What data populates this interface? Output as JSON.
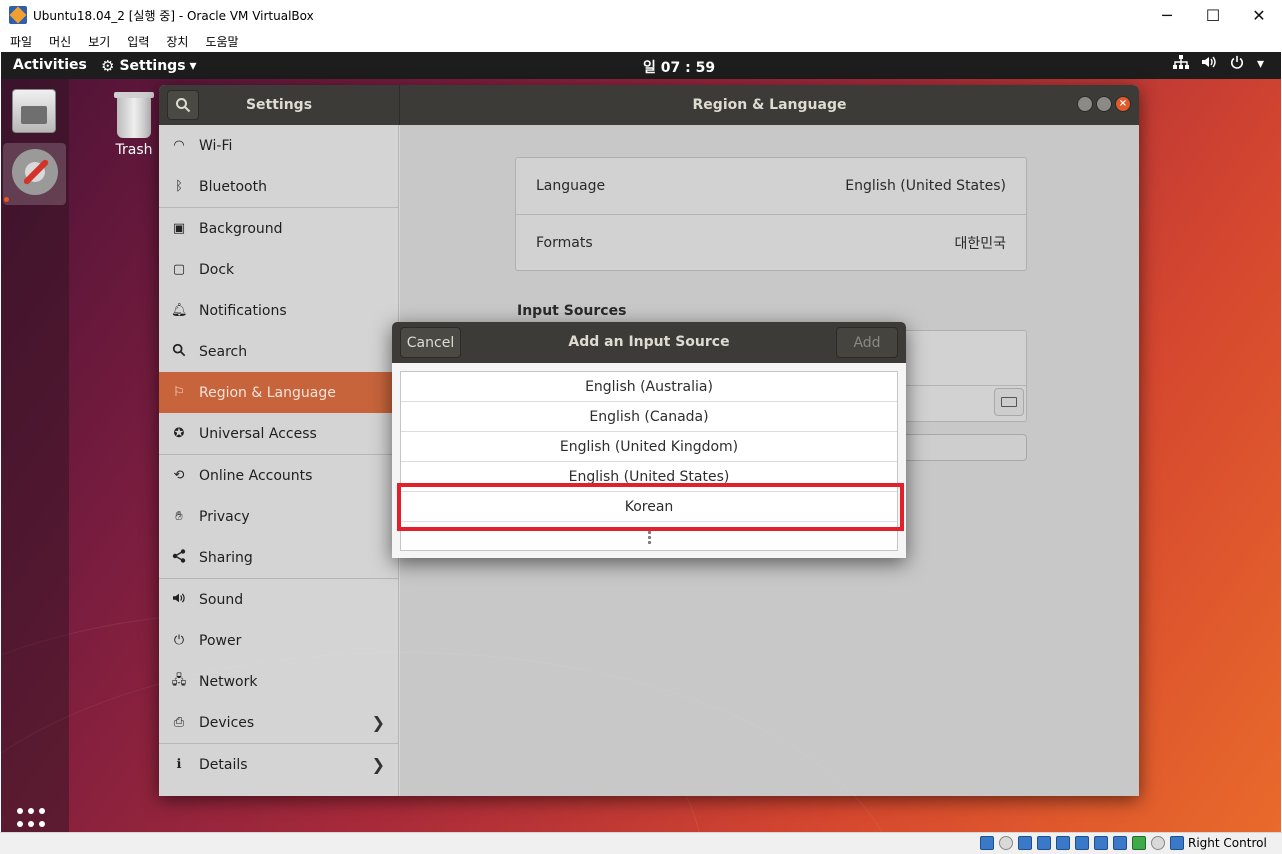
{
  "host": {
    "window_title": "Ubuntu18.04_2 [실행 중] - Oracle VM VirtualBox",
    "controls": {
      "minimize": "─",
      "maximize": "☐",
      "close": "✕"
    },
    "menu": [
      "파일",
      "머신",
      "보기",
      "입력",
      "장치",
      "도움말"
    ],
    "status_host_key": "Right Control"
  },
  "topbar": {
    "activities": "Activities",
    "app_menu": "Settings",
    "app_menu_arrow": "▾",
    "clock": "일 07 : 59"
  },
  "desktop": {
    "trash_label": "Trash"
  },
  "settings_window": {
    "sidebar_title": "Settings",
    "page_title": "Region & Language",
    "sidebar_items": [
      {
        "label": "Wi-Fi",
        "icon": "wifi-icon"
      },
      {
        "label": "Bluetooth",
        "icon": "bluetooth-icon"
      },
      {
        "label": "Background",
        "icon": "background-icon"
      },
      {
        "label": "Dock",
        "icon": "dock-icon"
      },
      {
        "label": "Notifications",
        "icon": "bell-icon"
      },
      {
        "label": "Search",
        "icon": "search-icon"
      },
      {
        "label": "Region & Language",
        "icon": "region-flag-icon",
        "active": true
      },
      {
        "label": "Universal Access",
        "icon": "accessibility-icon"
      },
      {
        "label": "Online Accounts",
        "icon": "online-accounts-icon"
      },
      {
        "label": "Privacy",
        "icon": "privacy-hand-icon"
      },
      {
        "label": "Sharing",
        "icon": "share-icon"
      },
      {
        "label": "Sound",
        "icon": "speaker-icon"
      },
      {
        "label": "Power",
        "icon": "power-plug-icon"
      },
      {
        "label": "Network",
        "icon": "network-icon"
      },
      {
        "label": "Devices",
        "icon": "devices-icon",
        "has_submenu": true
      },
      {
        "label": "Details",
        "icon": "info-icon",
        "has_submenu": true
      }
    ],
    "language_label": "Language",
    "language_value": "English (United States)",
    "formats_label": "Formats",
    "formats_value": "대한민국",
    "input_sources_heading": "Input Sources"
  },
  "dialog": {
    "cancel": "Cancel",
    "title": "Add an Input Source",
    "add": "Add",
    "options": [
      "English (Australia)",
      "English (Canada)",
      "English (United Kingdom)",
      "English (United States)",
      "Korean"
    ],
    "highlighted_option": "Korean"
  },
  "colors": {
    "accent": "#c7643b",
    "highlight_box": "#e3202a",
    "header_bg": "#3c3b37"
  }
}
